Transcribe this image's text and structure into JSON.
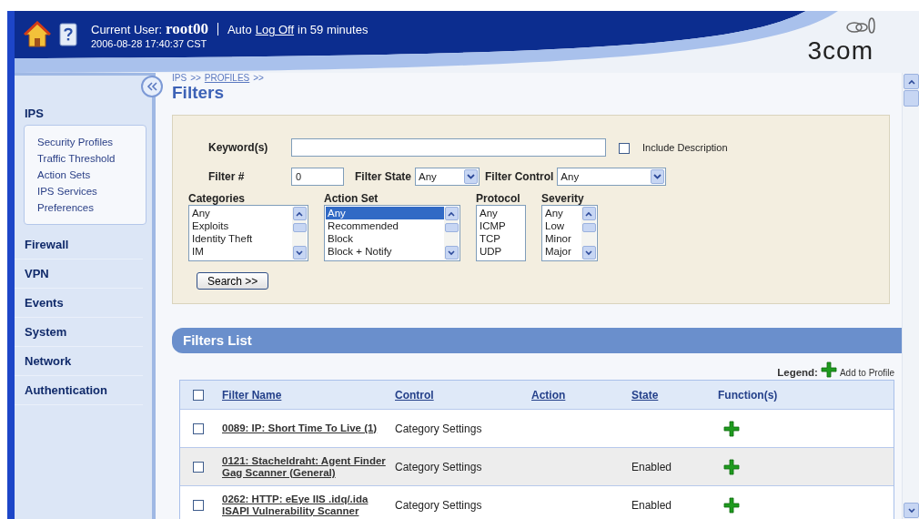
{
  "header": {
    "user_label": "Current User:",
    "user": "root00",
    "auto_text": "Auto",
    "logoff_link": "Log Off",
    "logoff_suffix": "in 59 minutes",
    "datetime": "2006-08-28 17:40:37 CST",
    "brand": "3com"
  },
  "sidebar": {
    "items": [
      {
        "label": "IPS",
        "expanded": true,
        "children": [
          {
            "label": "Security Profiles"
          },
          {
            "label": "Traffic Threshold"
          },
          {
            "label": "Action Sets"
          },
          {
            "label": "IPS Services"
          },
          {
            "label": "Preferences"
          }
        ]
      },
      {
        "label": "Firewall",
        "expanded": false
      },
      {
        "label": "VPN",
        "expanded": false
      },
      {
        "label": "Events",
        "expanded": false
      },
      {
        "label": "System",
        "expanded": false
      },
      {
        "label": "Network",
        "expanded": false
      },
      {
        "label": "Authentication",
        "expanded": false
      }
    ]
  },
  "breadcrumb": [
    {
      "label": "IPS",
      "link": false,
      "separator": ">>"
    },
    {
      "label": "PROFILES",
      "link": true,
      "separator": ">>"
    }
  ],
  "title": "Filters",
  "form": {
    "keyword": {
      "label": "Keyword(s)"
    },
    "include_description": {
      "label": "Include Description",
      "checked": false
    },
    "filter_number": {
      "label": "Filter #",
      "value": "0"
    },
    "filter_state": {
      "label": "Filter State",
      "value": "Any"
    },
    "filter_control": {
      "label": "Filter Control",
      "value": "Any"
    },
    "lists": [
      {
        "label": "Categories",
        "scrollable": true,
        "options": [
          {
            "label": "Any",
            "selected": false
          },
          {
            "label": "Exploits",
            "selected": false
          },
          {
            "label": "Identity Theft",
            "selected": false
          },
          {
            "label": "IM",
            "selected": false
          }
        ]
      },
      {
        "label": "Action Set",
        "scrollable": true,
        "options": [
          {
            "label": "Any",
            "selected": true
          },
          {
            "label": "Recommended",
            "selected": false
          },
          {
            "label": "Block",
            "selected": false
          },
          {
            "label": "Block + Notify",
            "selected": false
          }
        ]
      },
      {
        "label": "Protocol",
        "scrollable": false,
        "options": [
          {
            "label": "Any",
            "selected": false
          },
          {
            "label": "ICMP",
            "selected": false
          },
          {
            "label": "TCP",
            "selected": false
          },
          {
            "label": "UDP",
            "selected": false
          }
        ]
      },
      {
        "label": "Severity",
        "scrollable": true,
        "options": [
          {
            "label": "Any",
            "selected": false
          },
          {
            "label": "Low",
            "selected": false
          },
          {
            "label": "Minor",
            "selected": false
          },
          {
            "label": "Major",
            "selected": false
          }
        ]
      }
    ],
    "search_button": "Search >>"
  },
  "filters_list": {
    "title": "Filters List",
    "legend_label": "Legend:",
    "legend_text": "Add to Profile",
    "select_all": {
      "checked": false
    },
    "columns": [
      {
        "label": "Filter Name",
        "link": true
      },
      {
        "label": "Control",
        "link": true
      },
      {
        "label": "Action",
        "link": true
      },
      {
        "label": "State",
        "link": true
      },
      {
        "label": "Function(s)",
        "link": false
      }
    ],
    "rows": [
      {
        "name": "0089: IP: Short Time To Live (1)",
        "control": "Category Settings",
        "checked": false
      },
      {
        "name": "0121: Stacheldraht: Agent Finder Gag Scanner (General)",
        "control": "Category Settings",
        "state": "Enabled",
        "checked": false
      },
      {
        "name": "0262: HTTP: eEye IIS .idq/.ida ISAPI Vulnerability Scanner",
        "control": "Category Settings",
        "state": "Enabled",
        "checked": false
      }
    ]
  }
}
